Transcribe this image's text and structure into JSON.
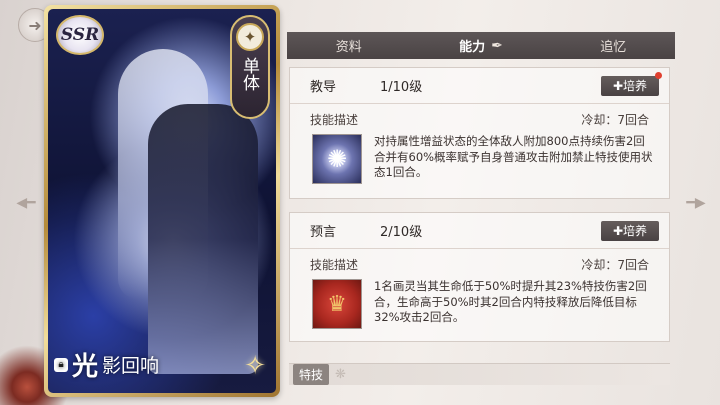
{
  "card": {
    "rarity": "SSR",
    "type_label": "单体",
    "name_first": "光",
    "name_rest": "影回响"
  },
  "tabs": [
    {
      "label": "资料"
    },
    {
      "label": "能力"
    },
    {
      "label": "追忆"
    }
  ],
  "skills": [
    {
      "name": "教导",
      "level": "1/10级",
      "train_label": "培养",
      "desc_label": "技能描述",
      "cooldown": "冷却：7回合",
      "description": "对持属性增益状态的全体敌人附加800点持续伤害2回合并有60%概率赋予自身普通攻击附加禁止特技使用状态1回合。"
    },
    {
      "name": "预言",
      "level": "2/10级",
      "train_label": "培养",
      "desc_label": "技能描述",
      "cooldown": "冷却：7回合",
      "description": "1名画灵当其生命低于50%时提升其23%特技伤害2回合，生命高于50%时其2回合内特技释放后降低目标32%攻击2回合。"
    }
  ],
  "trait_label": "特技",
  "icons": {
    "back": "back-arrow-icon",
    "nav_left": "left-arrow-icon",
    "nav_right": "right-arrow-icon",
    "type": "crossed-swords-icon",
    "quill": "quill-icon",
    "lock": "lock-icon",
    "sparkle": "sparkle-icon"
  }
}
